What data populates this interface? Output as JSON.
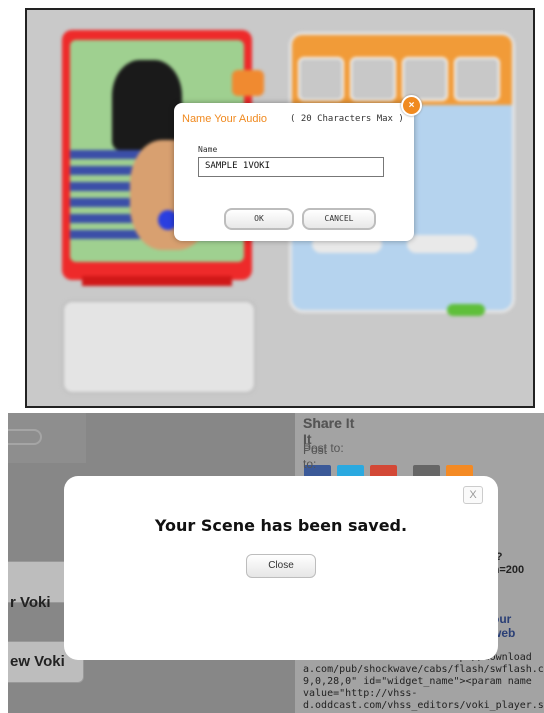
{
  "audio_dialog": {
    "title": "Name Your Audio",
    "max_note": "( 20 Characters Max )",
    "name_label": "Name",
    "name_value": "SAMPLE 1VOKI",
    "ok_label": "OK",
    "cancel_label": "CANCEL",
    "close_icon": "x-icon"
  },
  "save_dialog": {
    "message": "Your Scene has been saved.",
    "close_label": "Close",
    "close_icon_glyph": "X"
  },
  "share_panel": {
    "title": "Share It",
    "post_to": "Post to:",
    "partial_text_1": "o?",
    "partial_text_2": "th=200",
    "partial_heading": "our web",
    "embed_code": "                 .\n                 cf-96B8-\n444553540000 codebase=\"http://download\na.com/pub/shockwave/cabs/flash/swflash.c\n9,0,28,0\" id=\"widget_name\"><param name\nvalue=\"http://vhss-\nd.oddcast.com/vhss_editors/voki_player.sw"
  },
  "left_buttons": {
    "voki_1": "r Voki",
    "voki_2": "ew Voki"
  },
  "colors": {
    "accent_orange": "#f08a20",
    "social_icons": [
      "#3b5998",
      "#2aa9e0",
      "#d34836",
      "#666666",
      "#f48a24"
    ]
  }
}
